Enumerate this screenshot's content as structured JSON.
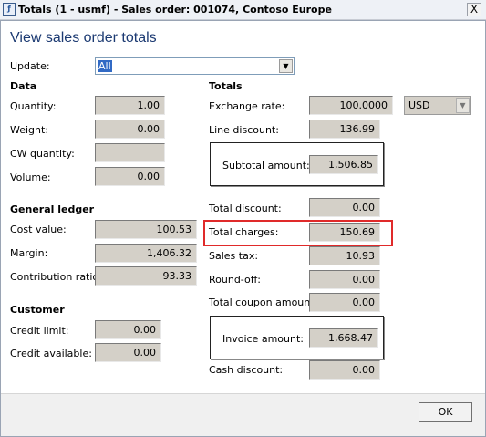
{
  "window": {
    "title": "Totals (1 - usmf) - Sales order: 001074, Contoso Europe",
    "icon": "app-window-icon",
    "close_label": "X"
  },
  "heading": "View sales order totals",
  "update": {
    "label": "Update:",
    "value": "All"
  },
  "data_section": {
    "title": "Data",
    "quantity_label": "Quantity:",
    "quantity": "1.00",
    "weight_label": "Weight:",
    "weight": "0.00",
    "cw_quantity_label": "CW quantity:",
    "cw_quantity": "",
    "volume_label": "Volume:",
    "volume": "0.00"
  },
  "general_ledger": {
    "title": "General ledger",
    "cost_value_label": "Cost value:",
    "cost_value": "100.53",
    "margin_label": "Margin:",
    "margin": "1,406.32",
    "contribution_ratio_label": "Contribution ratio:",
    "contribution_ratio": "93.33"
  },
  "customer": {
    "title": "Customer",
    "credit_limit_label": "Credit limit:",
    "credit_limit": "0.00",
    "credit_available_label": "Credit available:",
    "credit_available": "0.00"
  },
  "totals": {
    "title": "Totals",
    "exchange_rate_label": "Exchange rate:",
    "exchange_rate": "100.0000",
    "currency": "USD",
    "line_discount_label": "Line discount:",
    "line_discount": "136.99",
    "subtotal_label": "Subtotal amount:",
    "subtotal": "1,506.85",
    "total_discount_label": "Total discount:",
    "total_discount": "0.00",
    "total_charges_label": "Total charges:",
    "total_charges": "150.69",
    "sales_tax_label": "Sales tax:",
    "sales_tax": "10.93",
    "round_off_label": "Round-off:",
    "round_off": "0.00",
    "total_coupon_label": "Total coupon amount:",
    "total_coupon": "0.00",
    "invoice_label": "Invoice amount:",
    "invoice": "1,668.47",
    "cash_discount_label": "Cash discount:",
    "cash_discount": "0.00"
  },
  "footer": {
    "ok_label": "OK"
  },
  "colors": {
    "highlight": "#e02a2a",
    "heading": "#1c3a72",
    "field_bg": "#d4d0c8"
  }
}
